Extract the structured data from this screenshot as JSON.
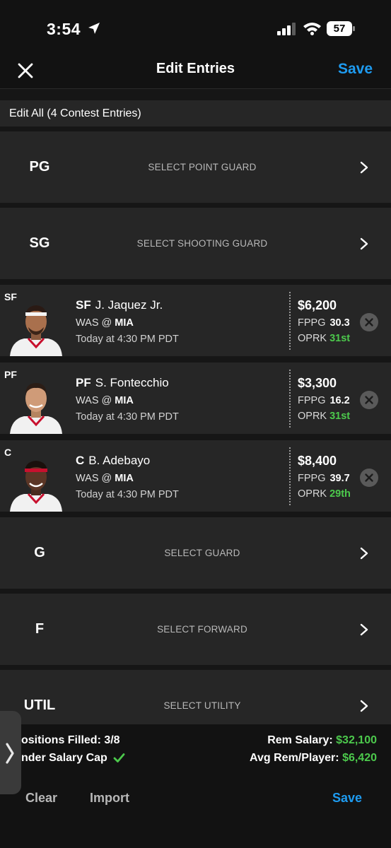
{
  "status_bar": {
    "time": "3:54",
    "battery": "57"
  },
  "header": {
    "title": "Edit Entries",
    "save_label": "Save"
  },
  "edit_all_label": "Edit All (4 Contest Entries)",
  "slots": [
    {
      "pos": "PG",
      "label": "SELECT POINT GUARD"
    },
    {
      "pos": "SG",
      "label": "SELECT SHOOTING GUARD"
    },
    {
      "pos": "G",
      "label": "SELECT GUARD"
    },
    {
      "pos": "F",
      "label": "SELECT FORWARD"
    },
    {
      "pos": "UTIL",
      "label": "SELECT UTILITY"
    }
  ],
  "players": [
    {
      "slot": "SF",
      "pos": "SF",
      "name": "J. Jaquez Jr.",
      "team": "WAS @",
      "opp": "MIA",
      "time": "Today at 4:30 PM PDT",
      "salary": "$6,200",
      "fppg_label": "FPPG",
      "fppg": "30.3",
      "oprk_label": "OPRK",
      "oprk": "31st"
    },
    {
      "slot": "PF",
      "pos": "PF",
      "name": "S. Fontecchio",
      "team": "WAS @",
      "opp": "MIA",
      "time": "Today at 4:30 PM PDT",
      "salary": "$3,300",
      "fppg_label": "FPPG",
      "fppg": "16.2",
      "oprk_label": "OPRK",
      "oprk": "31st"
    },
    {
      "slot": "C",
      "pos": "C",
      "name": "B. Adebayo",
      "team": "WAS @",
      "opp": "MIA",
      "time": "Today at 4:30 PM PDT",
      "salary": "$8,400",
      "fppg_label": "FPPG",
      "fppg": "39.7",
      "oprk_label": "OPRK",
      "oprk": "29th"
    }
  ],
  "summary": {
    "positions_filled": "ositions Filled: 3/8",
    "salary_cap": "nder Salary Cap",
    "rem_salary_label": "Rem Salary:",
    "rem_salary": "$32,100",
    "avg_rem_label": "Avg Rem/Player:",
    "avg_rem": "$6,420"
  },
  "footer": {
    "clear": "Clear",
    "import": "Import",
    "save": "Save"
  },
  "colors": {
    "accent": "#1e9bf0",
    "positive": "#4cc94c",
    "row_bg": "#262626",
    "page_bg": "#161616"
  }
}
